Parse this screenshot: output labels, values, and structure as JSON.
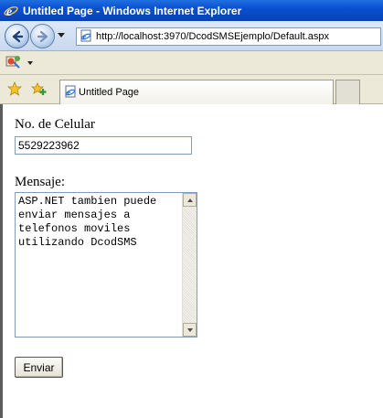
{
  "window": {
    "title": "Untitled Page - Windows Internet Explorer"
  },
  "address_bar": {
    "url": "http://localhost:3970/DcodSMSEjemplo/Default.aspx"
  },
  "tabs": [
    {
      "label": "Untitled Page"
    }
  ],
  "form": {
    "phone_label": "No. de Celular",
    "phone_value": "5529223962",
    "message_label": "Mensaje:",
    "message_value": "ASP.NET tambien puede\nenviar mensajes a\ntelefonos moviles\nutilizando DcodSMS",
    "send_label": "Enviar"
  },
  "icons": {
    "window_icon": "ie-logo-icon",
    "back": "back-arrow-icon",
    "forward": "forward-arrow-icon",
    "page": "page-icon",
    "favorites": "favorites-star-icon",
    "add_favorites": "add-favorites-icon",
    "feeds": "feeds-icon"
  },
  "colors": {
    "titlebar": "#0a4fd0",
    "chrome": "#ece9d8"
  }
}
